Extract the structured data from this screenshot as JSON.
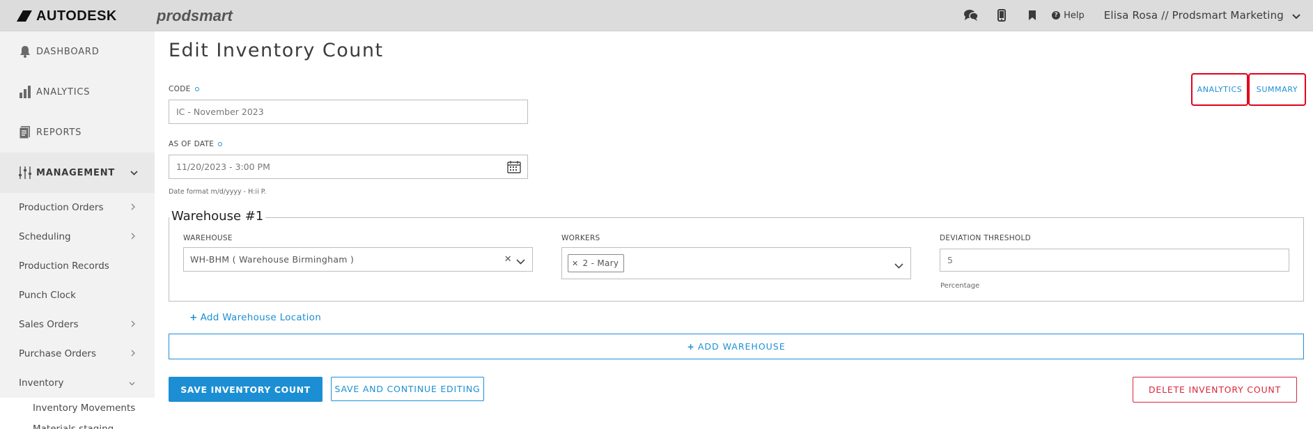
{
  "header": {
    "brand": "AUTODESK",
    "product": "prodsmart",
    "help_label": "Help",
    "user_label": "Elisa Rosa // Prodsmart Marketing",
    "icons": [
      "chat-icon",
      "mobile-icon",
      "bookmark-icon",
      "help-icon",
      "chevron-down-icon"
    ]
  },
  "sidebar": {
    "main_items": [
      {
        "label": "DASHBOARD",
        "icon": "bell-icon"
      },
      {
        "label": "ANALYTICS",
        "icon": "bar-chart-icon"
      },
      {
        "label": "REPORTS",
        "icon": "report-icon"
      },
      {
        "label": "MANAGEMENT",
        "icon": "sliders-icon"
      }
    ],
    "sub_items": [
      {
        "label": "Production Orders"
      },
      {
        "label": "Scheduling"
      },
      {
        "label": "Production Records"
      },
      {
        "label": "Punch Clock"
      },
      {
        "label": "Sales Orders"
      },
      {
        "label": "Purchase Orders"
      },
      {
        "label": "Inventory"
      }
    ],
    "inventory_items": [
      {
        "label": "Inventory Movements"
      },
      {
        "label": "Materials staging"
      }
    ]
  },
  "main": {
    "title": "Edit Inventory Count",
    "tabs": {
      "analytics": "ANALYTICS",
      "summary": "SUMMARY"
    },
    "code": {
      "label": "CODE",
      "value": "IC - November 2023"
    },
    "as_of_date": {
      "label": "AS OF DATE",
      "value": "11/20/2023 - 3:00 PM",
      "hint": "Date format m/d/yyyy - H:ii P."
    },
    "warehouse_block": {
      "title": "Warehouse #1",
      "warehouse_label": "WAREHOUSE",
      "warehouse_value": "WH-BHM ( Warehouse Birmingham )",
      "workers_label": "WORKERS",
      "workers_tag": "2 - Mary",
      "deviation_label": "DEVIATION THRESHOLD",
      "deviation_value": "5",
      "deviation_hint": "Percentage"
    },
    "add_location_label": "Add Warehouse Location",
    "add_warehouse_label": "ADD WAREHOUSE",
    "buttons": {
      "save": "SAVE INVENTORY COUNT",
      "save_continue": "SAVE AND CONTINUE EDITING",
      "delete": "DELETE INVENTORY COUNT"
    }
  },
  "colors": {
    "accent": "#1c8fd4",
    "danger": "#d9263c",
    "highlight_border": "#e3001b",
    "topbar": "#dcdcdc",
    "sidebar": "#f2f2f2"
  }
}
